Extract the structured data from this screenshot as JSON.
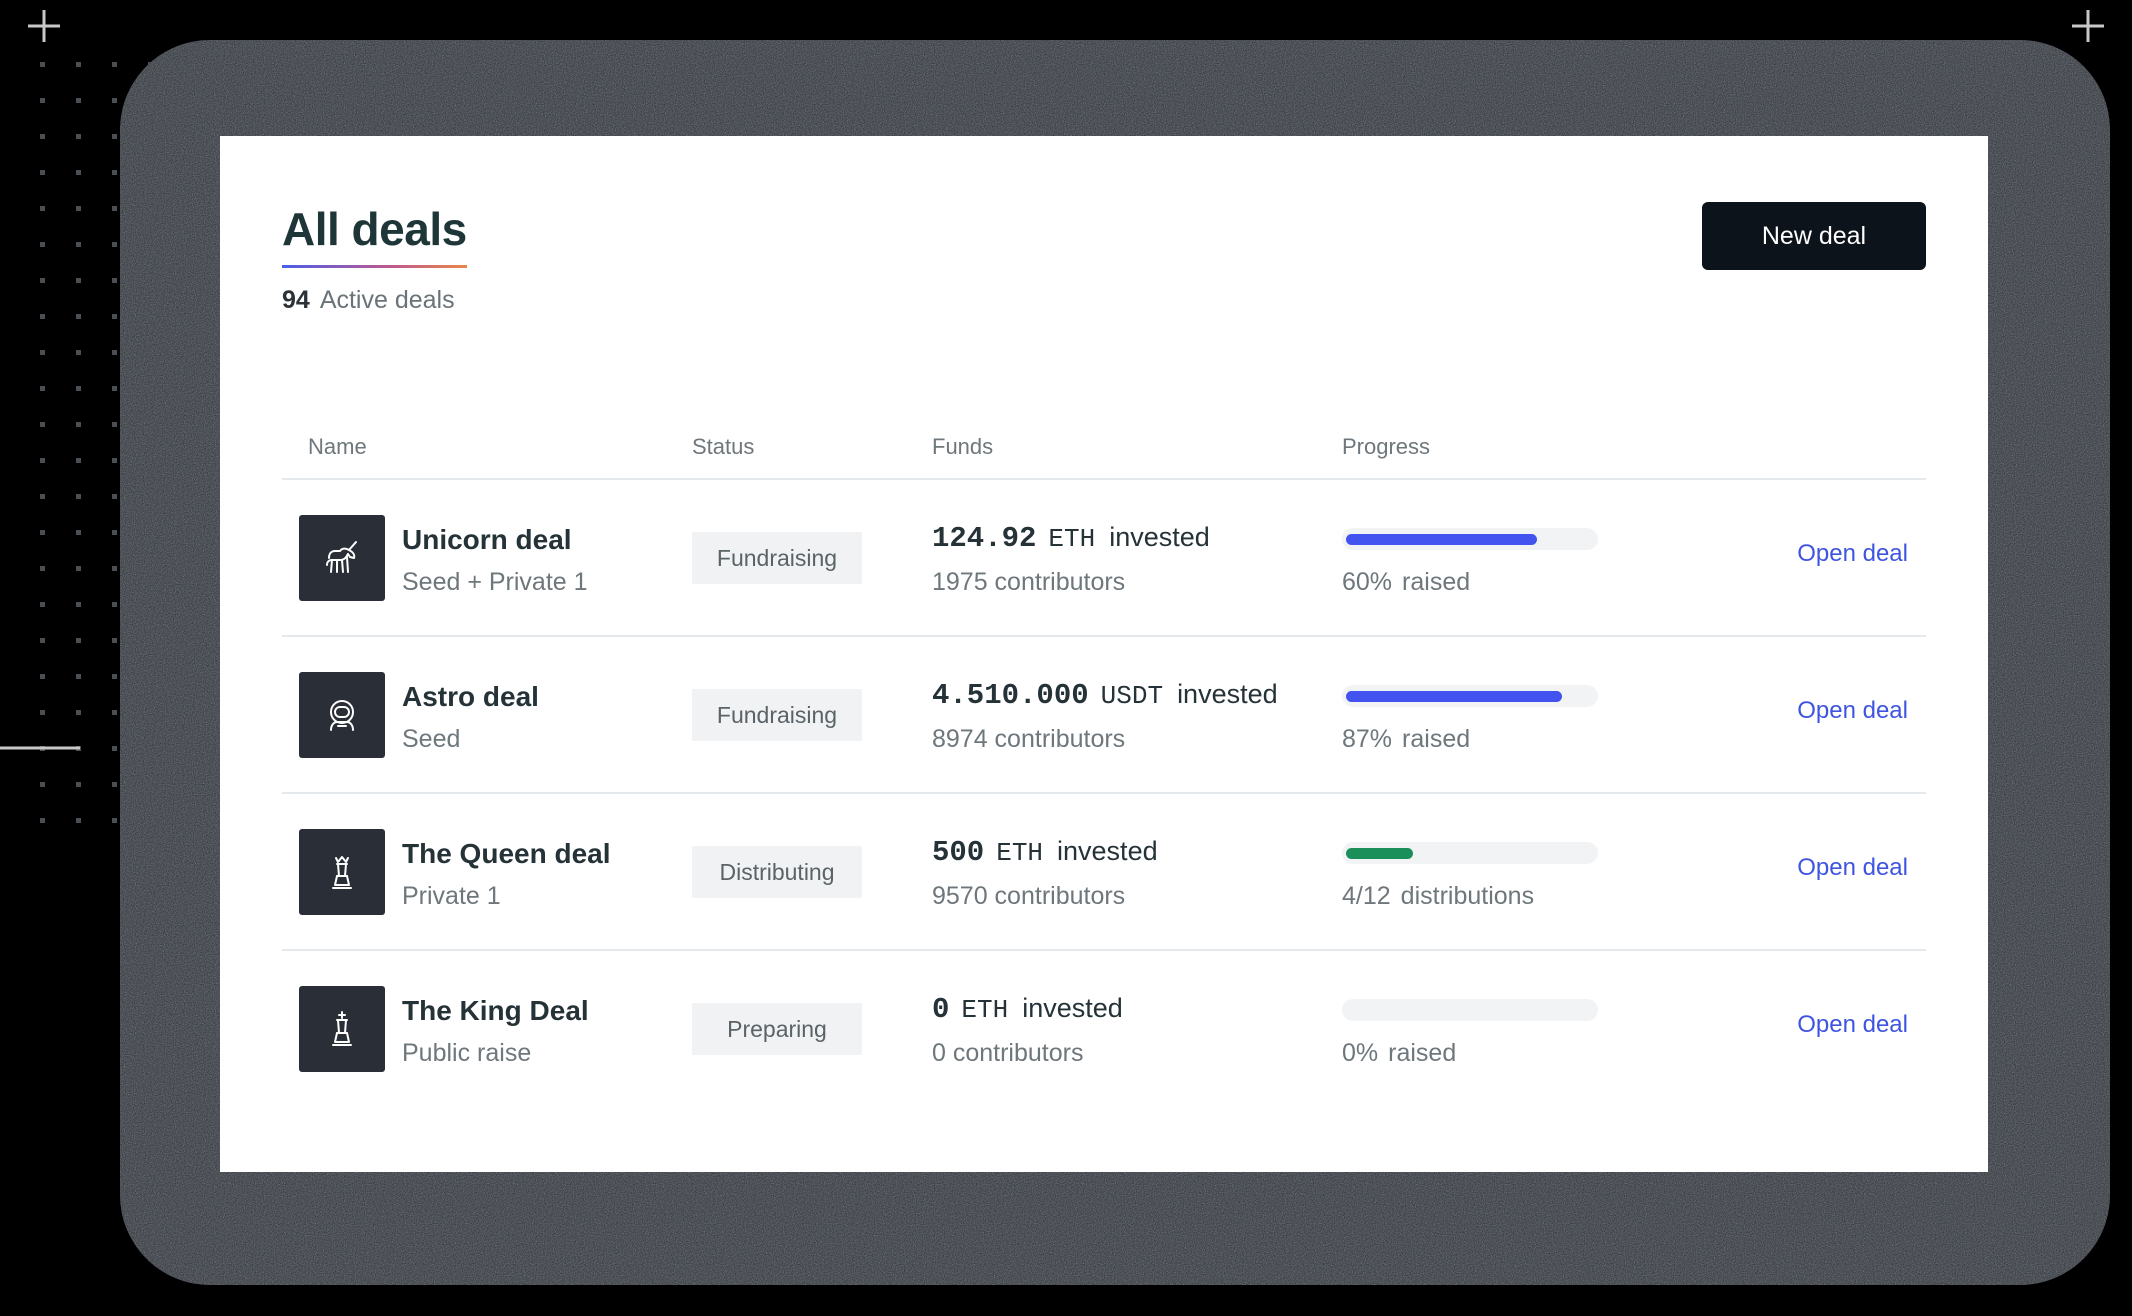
{
  "header": {
    "title": "All deals",
    "active_count": "94",
    "active_label": "Active deals",
    "new_deal_label": "New deal"
  },
  "table": {
    "columns": {
      "name": "Name",
      "status": "Status",
      "funds": "Funds",
      "progress": "Progress"
    },
    "rows": [
      {
        "name": "Unicorn deal",
        "round": "Seed + Private 1",
        "icon": "unicorn-icon",
        "status": "Fundraising",
        "amount": "124.92",
        "currency": "ETH",
        "invested_label": "invested",
        "contributors": "1975 contributors",
        "progress_fraction": 0.77,
        "progress_color": "#4353f0",
        "progress_value": "60%",
        "progress_suffix": "raised",
        "action": "Open deal"
      },
      {
        "name": "Astro deal",
        "round": "Seed",
        "icon": "astronaut-icon",
        "status": "Fundraising",
        "amount": "4.510.000",
        "currency": "USDT",
        "invested_label": "invested",
        "contributors": "8974 contributors",
        "progress_fraction": 0.87,
        "progress_color": "#4353f0",
        "progress_value": "87%",
        "progress_suffix": "raised",
        "action": "Open deal"
      },
      {
        "name": "The Queen deal",
        "round": "Private 1",
        "icon": "chess-queen-icon",
        "status": "Distributing",
        "amount": "500",
        "currency": "ETH",
        "invested_label": "invested",
        "contributors": "9570 contributors",
        "progress_fraction": 0.27,
        "progress_color": "#1a8f5a",
        "progress_value": "4/12",
        "progress_suffix": "distributions",
        "action": "Open deal"
      },
      {
        "name": "The King Deal",
        "round": "Public raise",
        "icon": "chess-king-icon",
        "status": "Preparing",
        "amount": "0",
        "currency": "ETH",
        "invested_label": "invested",
        "contributors": "0 contributors",
        "progress_fraction": 0,
        "progress_color": "#4353f0",
        "progress_value": "0%",
        "progress_suffix": "raised",
        "action": "Open deal"
      }
    ]
  }
}
